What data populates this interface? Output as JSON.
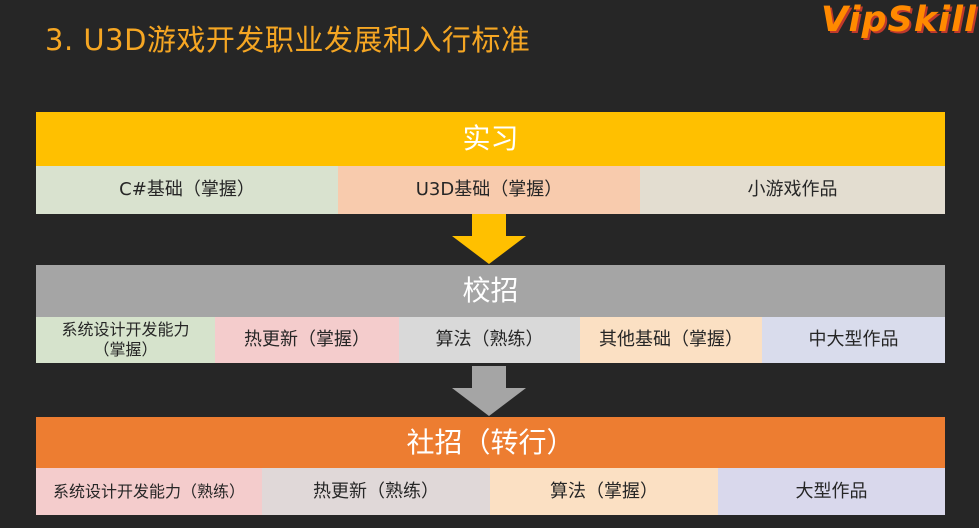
{
  "title": "3. U3D游戏开发职业发展和入行标准",
  "logo": "VipSkill",
  "stages": {
    "intern": {
      "label": "实习",
      "color": "#ffc000",
      "items": [
        {
          "text": "C#基础（掌握）",
          "color": "#d9e2cf"
        },
        {
          "text": "U3D基础（掌握）",
          "color": "#f8cbad"
        },
        {
          "text": "小游戏作品",
          "color": "#e3ddd0"
        }
      ]
    },
    "campus": {
      "label": "校招",
      "color": "#a5a5a5",
      "items": [
        {
          "text": "系统设计开发能力\n（掌握）",
          "color": "#d6e3cc"
        },
        {
          "text": "热更新（掌握）",
          "color": "#f4cccc"
        },
        {
          "text": "算法（熟练）",
          "color": "#d9d9d9"
        },
        {
          "text": "其他基础（掌握）",
          "color": "#fbe0c3"
        },
        {
          "text": "中大型作品",
          "color": "#d9dcec"
        }
      ]
    },
    "social": {
      "label": "社招（转行）",
      "color": "#ed7d31",
      "items": [
        {
          "text": "系统设计开发能力（熟练）",
          "color": "#f4cccc"
        },
        {
          "text": "热更新（熟练）",
          "color": "#e0d8d8"
        },
        {
          "text": "算法（掌握）",
          "color": "#fbe0c3"
        },
        {
          "text": "大型作品",
          "color": "#d9d8ec"
        }
      ]
    }
  }
}
